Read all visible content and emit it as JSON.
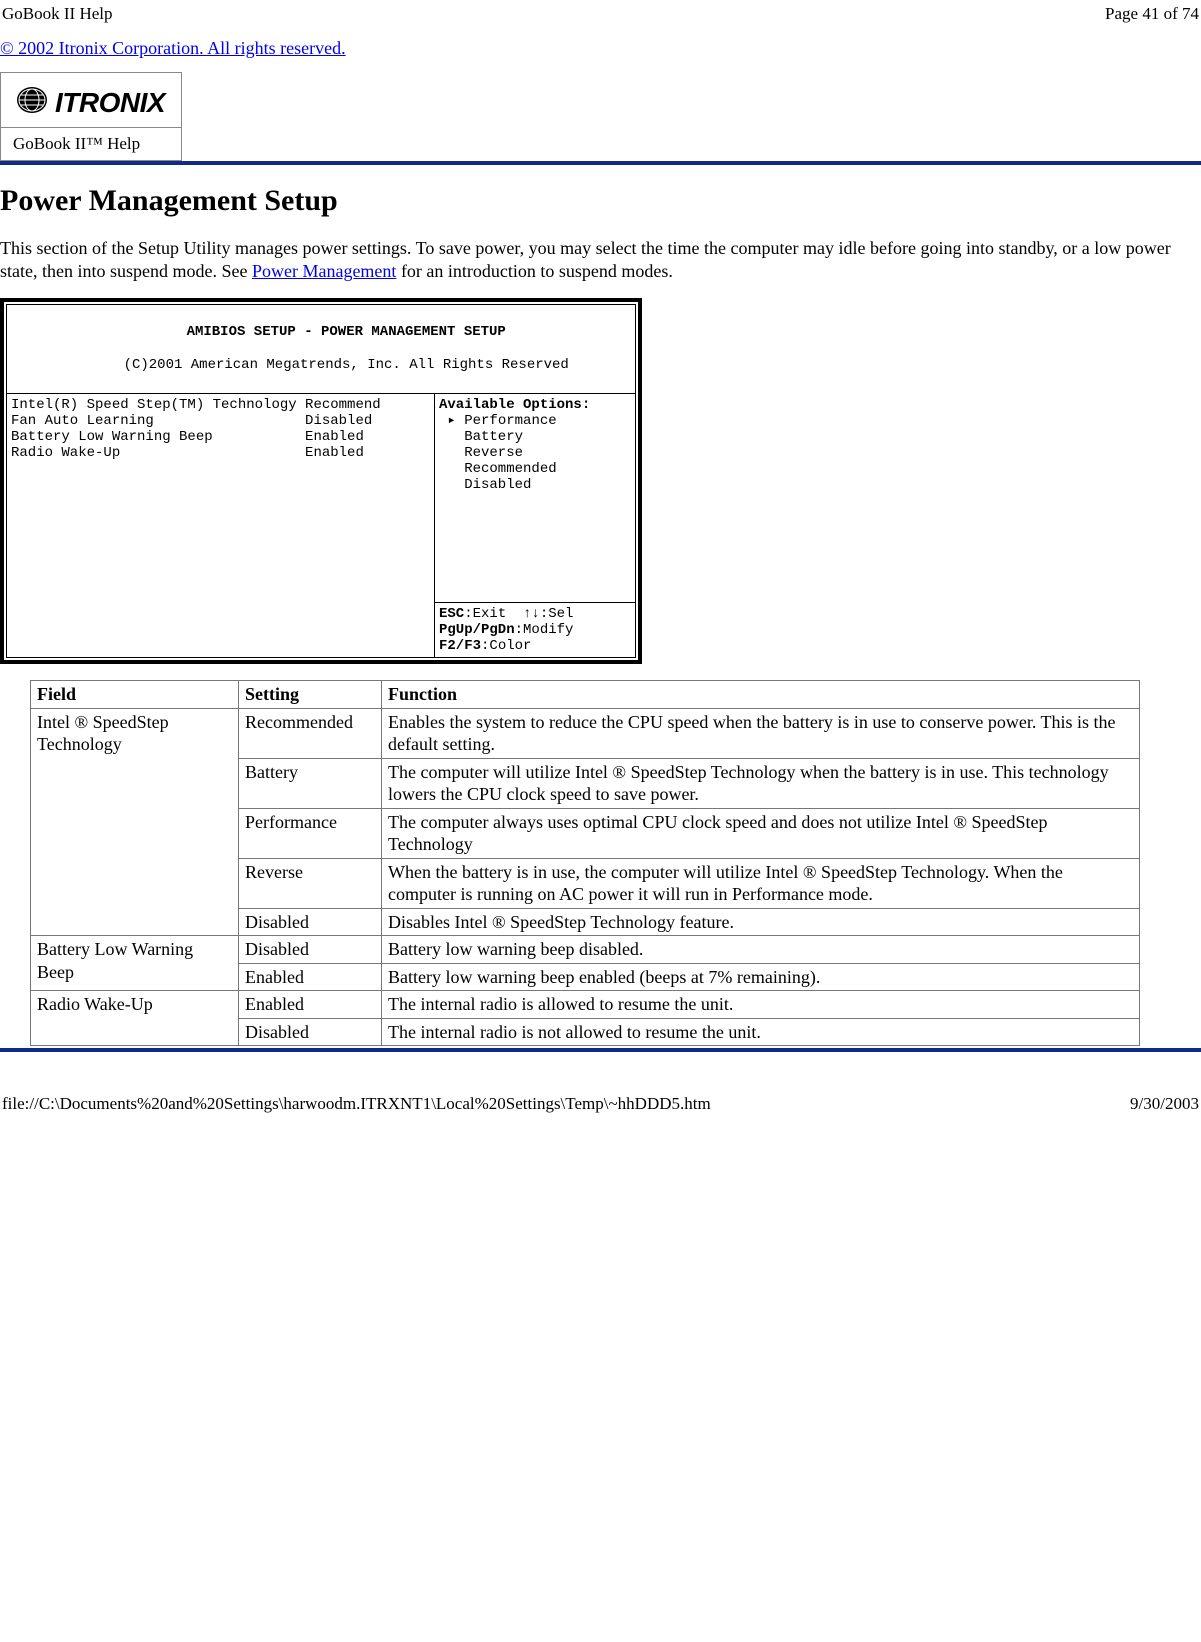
{
  "top": {
    "left": "GoBook II Help",
    "right": "Page 41 of 74"
  },
  "copyright": "© 2002 Itronix Corporation.  All rights reserved.",
  "brand": {
    "name": "ITRONIX",
    "helpLabel": "GoBook II™ Help"
  },
  "section": {
    "title": "Power Management Setup",
    "introBefore": "This section of the Setup Utility manages power settings.  To save power, you may select the time the computer may idle before going into standby, or a low power state, then into suspend mode.  See ",
    "introLink": "Power Management",
    "introAfter": " for an introduction to suspend modes."
  },
  "bios": {
    "headerTitle": "AMIBIOS SETUP - POWER MANAGEMENT SETUP",
    "headerSub": "(C)2001 American Megatrends, Inc. All Rights Reserved",
    "leftLines": [
      "Intel(R) Speed Step(TM) Technology Recommend",
      "Fan Auto Learning                  Disabled",
      "Battery Low Warning Beep           Enabled",
      "Radio Wake-Up                      Enabled"
    ],
    "rightTitle": "Available Options:",
    "rightOptions": [
      "Performance",
      "Battery",
      "Reverse",
      "Recommended",
      "Disabled"
    ],
    "rightSelectedIndex": 0,
    "extraBlankLines": 12,
    "footer": {
      "l1a": "ESC",
      "l1b": ":Exit  ",
      "l1c": "↑↓",
      "l1d": ":Sel",
      "l2a": "PgUp/PgDn",
      "l2b": ":Modify",
      "l3a": "F2/F3",
      "l3b": ":Color"
    }
  },
  "table": {
    "headers": {
      "field": "Field",
      "setting": "Setting",
      "function": "Function"
    },
    "rows": [
      {
        "field": "Intel ® SpeedStep Technology",
        "setting": "Recommended",
        "function": "Enables the system to reduce the CPU speed when the battery is in use to conserve power. This is the default setting.",
        "rowspan": 5
      },
      {
        "setting": "Battery",
        "function": "The computer will utilize Intel ® SpeedStep Technology when the battery is in use.  This technology lowers the CPU clock speed to save power."
      },
      {
        "setting": "Performance",
        "function": "The computer always uses optimal CPU clock speed and does not utilize Intel ® SpeedStep Technology"
      },
      {
        "setting": "Reverse",
        "function": "When the battery is in use, the computer will utilize Intel ® SpeedStep Technology.  When the computer is running on AC power it will run in Performance mode."
      },
      {
        "setting": "Disabled",
        "function": "Disables Intel ® SpeedStep Technology feature."
      },
      {
        "field": "Battery Low Warning Beep",
        "setting": "Disabled",
        "function": "Battery low warning beep disabled.",
        "rowspan": 2
      },
      {
        "setting": "Enabled",
        "function": "Battery low warning beep enabled (beeps at 7% remaining)."
      },
      {
        "field": "Radio Wake-Up",
        "setting": "Enabled",
        "function": "The internal radio is allowed to resume the unit.",
        "rowspan": 2
      },
      {
        "setting": "Disabled",
        "function": "The internal radio is not allowed to resume the unit."
      }
    ]
  },
  "footer": {
    "path": "file://C:\\Documents%20and%20Settings\\harwoodm.ITRXNT1\\Local%20Settings\\Temp\\~hhDDD5.htm",
    "date": "9/30/2003"
  }
}
